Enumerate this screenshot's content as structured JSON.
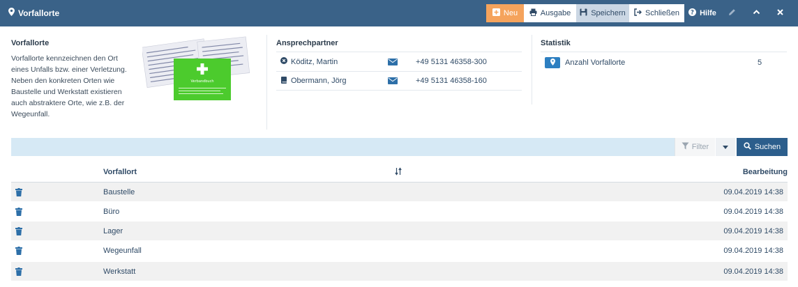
{
  "app": {
    "title": "Vorfallorte"
  },
  "toolbar": {
    "new_label": "Neu",
    "output_label": "Ausgabe",
    "save_label": "Speichern",
    "close_label": "Schließen",
    "help_label": "Hilfe",
    "icons": [
      "pencil-icon",
      "chevron-up-icon",
      "close-icon"
    ]
  },
  "info": {
    "title": "Vorfallorte",
    "description": "Vorfallorte kennzeichnen den Ort eines Unfalls bzw. einer Verletzung. Neben den konkreten Orten wie Baustelle und Werkstatt existieren auch abstraktere Orte, wie z.B. der Wegeunfall.",
    "image_caption": "Verbandbuch"
  },
  "contacts": {
    "title": "Ansprechpartner",
    "items": [
      {
        "name": "Köditz, Martin",
        "icon": "x-circle-icon",
        "phone": "+49 5131 46358-300"
      },
      {
        "name": "Obermann, Jörg",
        "icon": "book-icon",
        "phone": "+49 5131 46358-160"
      }
    ]
  },
  "stats": {
    "title": "Statistik",
    "items": [
      {
        "label": "Anzahl Vorfallorte",
        "value": "5",
        "icon": "map-pin-icon"
      }
    ]
  },
  "search": {
    "filter_label": "Filter",
    "search_label": "Suchen"
  },
  "table": {
    "columns": {
      "name": "Vorfallort",
      "date": "Bearbeitung"
    },
    "rows": [
      {
        "name": "Baustelle",
        "date": "09.04.2019 14:38"
      },
      {
        "name": "Büro",
        "date": "09.04.2019 14:38"
      },
      {
        "name": "Lager",
        "date": "09.04.2019 14:38"
      },
      {
        "name": "Wegeunfall",
        "date": "09.04.2019 14:38"
      },
      {
        "name": "Werkstatt",
        "date": "09.04.2019 14:38"
      }
    ]
  },
  "colors": {
    "header_bg": "#3a6288",
    "accent_orange": "#f5a35c",
    "primary_blue": "#2c5e8c",
    "search_bar_bg": "#d6e9f5",
    "text": "#2f4a66"
  }
}
